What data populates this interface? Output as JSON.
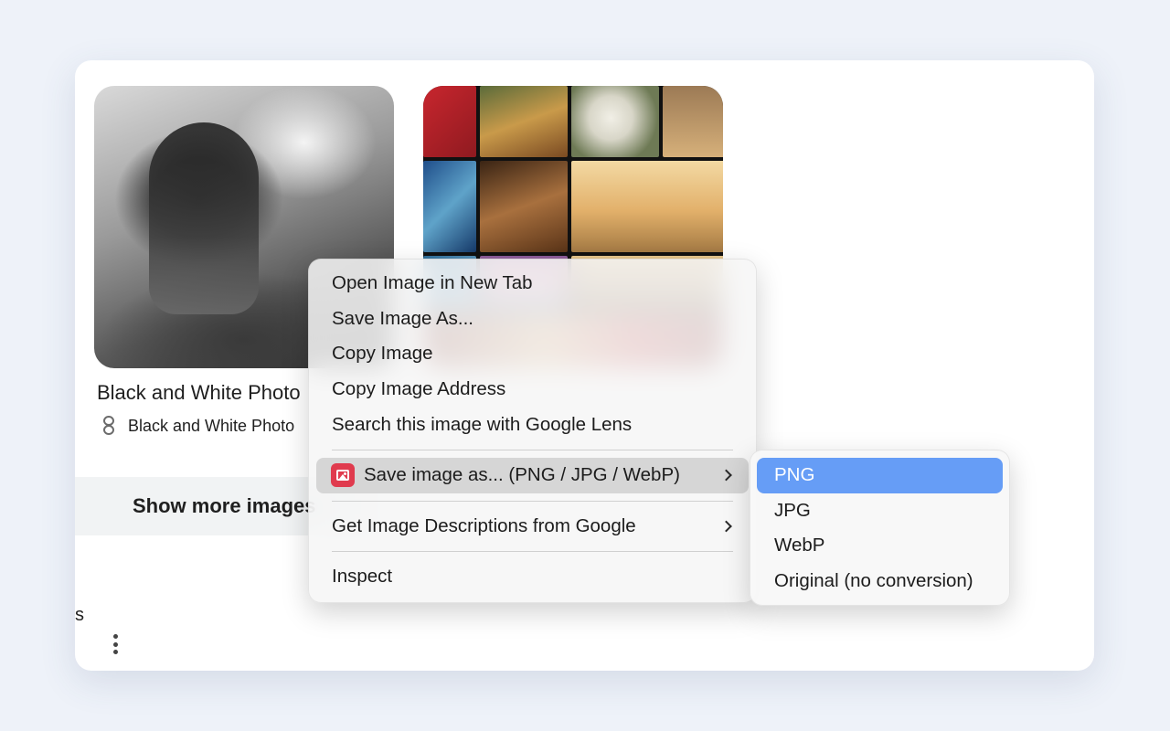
{
  "results": {
    "first": {
      "title": "Black and White Photo",
      "source": "Black and White Photo"
    },
    "show_more_label": "Show more images",
    "stray_text": "s"
  },
  "context_menu": {
    "items": [
      {
        "label": "Open Image in New Tab"
      },
      {
        "label": "Save Image As..."
      },
      {
        "label": "Copy Image"
      },
      {
        "label": "Copy Image Address"
      },
      {
        "label": "Search this image with Google Lens"
      }
    ],
    "extension_item": {
      "label": "Save image as... (PNG / JPG / WebP)",
      "icon": "image-icon"
    },
    "descriptions_item": {
      "label": "Get Image Descriptions from Google"
    },
    "inspect_item": {
      "label": "Inspect"
    }
  },
  "submenu": {
    "items": [
      {
        "label": "PNG",
        "selected": true
      },
      {
        "label": "JPG"
      },
      {
        "label": "WebP"
      },
      {
        "label": "Original (no conversion)"
      }
    ]
  },
  "colors": {
    "highlight": "#669df6",
    "extension_icon": "#e03b4e",
    "page_bg": "#eef2f9"
  }
}
